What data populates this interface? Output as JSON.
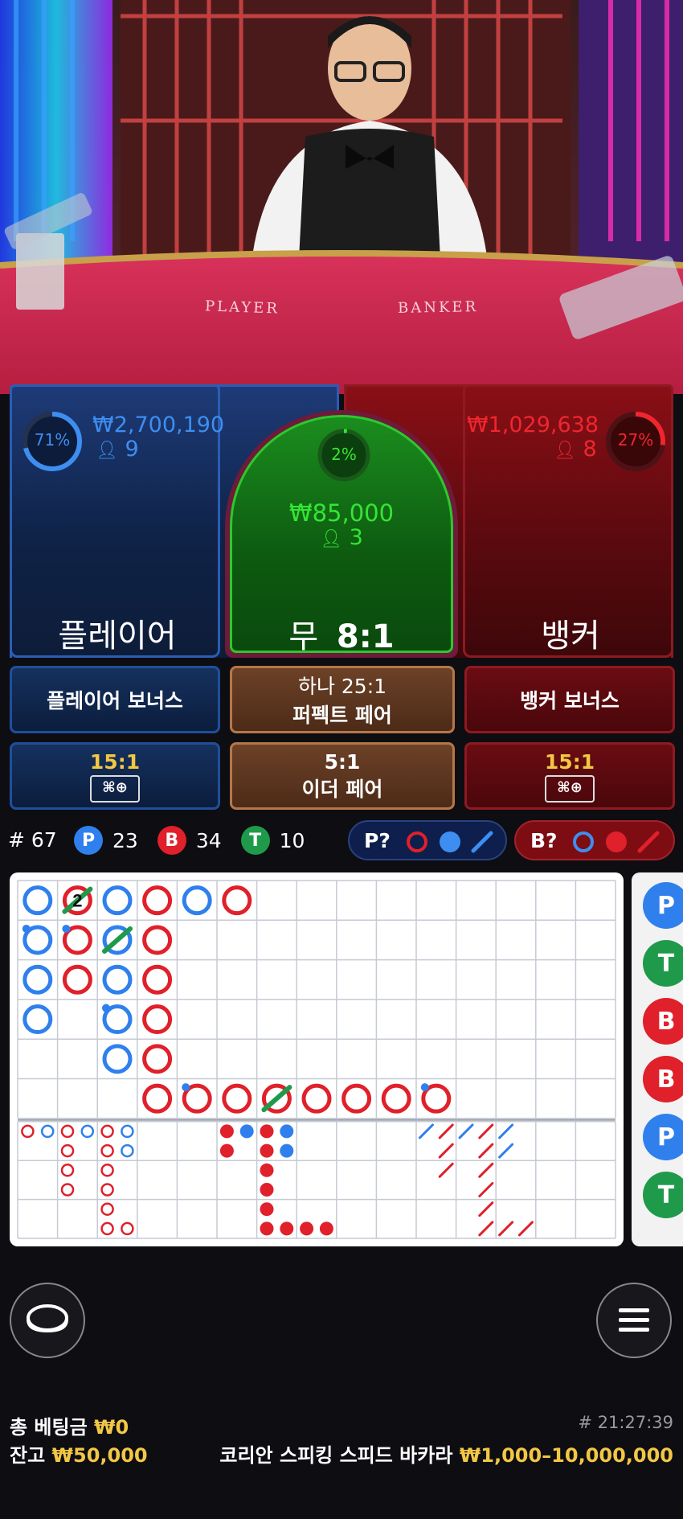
{
  "table_felt": {
    "player_label": "PLAYER",
    "banker_label": "BANKER"
  },
  "player": {
    "percent": "71%",
    "percent_value": 71,
    "amount": "₩2,700,190",
    "count": "9",
    "label": "플레이어",
    "color": "#3d8ef0"
  },
  "tie": {
    "percent": "2%",
    "percent_value": 2,
    "amount": "₩85,000",
    "count": "3",
    "label": "무",
    "odds": "8:1",
    "color": "#35e535"
  },
  "banker": {
    "percent": "27%",
    "percent_value": 27,
    "amount": "₩1,029,638",
    "count": "8",
    "label": "뱅커",
    "color": "#f0262e"
  },
  "side_bets": {
    "player_bonus": "플레이어 보너스",
    "perfect_pair_line1": "하나 25:1",
    "perfect_pair_line2": "퍼펙트 페어",
    "banker_bonus": "뱅커 보너스",
    "player_pair_odds": "15:1",
    "either_pair_line1": "5:1",
    "either_pair_line2": "이더 페어",
    "banker_pair_odds": "15:1"
  },
  "stats": {
    "round_prefix": "#",
    "round": "67",
    "p_letter": "P",
    "p_count": "23",
    "b_letter": "B",
    "b_count": "34",
    "t_letter": "T",
    "t_count": "10",
    "player_predict": "P?",
    "banker_predict": "B?"
  },
  "side_road_letters": [
    "P",
    "T",
    "B",
    "B",
    "P",
    "T"
  ],
  "footer": {
    "total_bet_label": "총 베팅금",
    "total_bet_value": "₩0",
    "balance_label": "잔고",
    "balance_value": "₩50,000",
    "game_id": "# 21:27:39",
    "table_name": "코리안 스피킹 스피드 바카라",
    "limits": "₩1,000–10,000,000"
  },
  "colors": {
    "player": "#3d8ef0",
    "banker": "#f0262e",
    "tie": "#1f9a4a",
    "gold": "#f2c744"
  }
}
